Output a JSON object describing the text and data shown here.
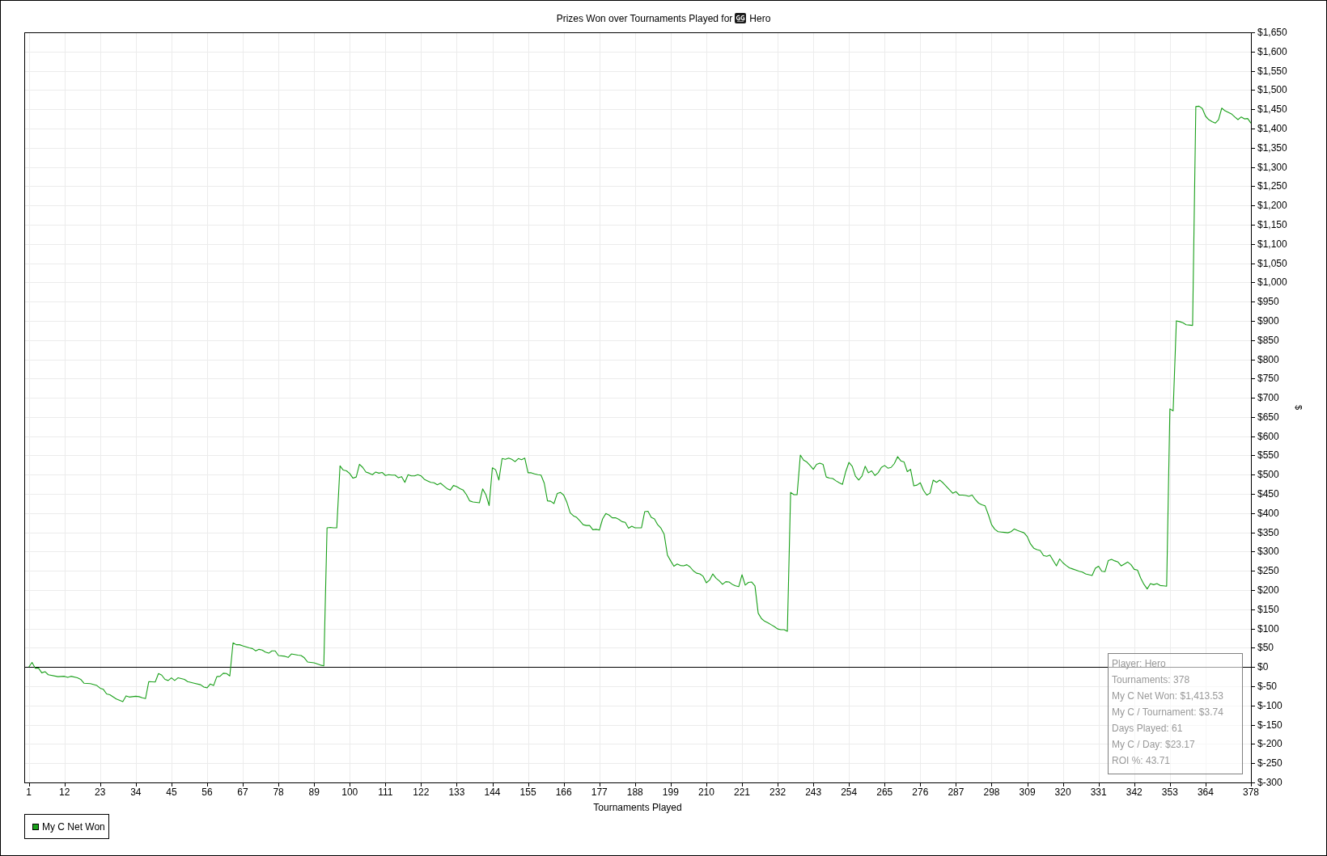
{
  "chart": {
    "title_player": "Hero",
    "summary_box": {
      "lines": [
        "Player: Hero",
        "Tournaments: 378",
        "My C Net Won: $1,413.53",
        "My C / Tournament: $3.74",
        "Days Played: 61",
        "My C / Day: $23.17",
        "ROI %: 43.71"
      ]
    },
    "chart_data": {
      "type": "line",
      "title": "Prizes Won over Tournaments Played for",
      "xlabel": "Tournaments Played",
      "ylabel": "$",
      "grid": true,
      "x": [
        1,
        2,
        3,
        4,
        5,
        6,
        7,
        10,
        12,
        13,
        14,
        16,
        17,
        18,
        20,
        22,
        23,
        24,
        25,
        26,
        28,
        30,
        31,
        32,
        34,
        35,
        36,
        37,
        38,
        40,
        41,
        42,
        43,
        44,
        45,
        46,
        47,
        49,
        50,
        52,
        54,
        55,
        56,
        57,
        58,
        59,
        60,
        61,
        62,
        63,
        64,
        65,
        66,
        67,
        69,
        70,
        71,
        72,
        73,
        74,
        75,
        76,
        77,
        78,
        80,
        81,
        82,
        84,
        85,
        86,
        87,
        88,
        89,
        91,
        92,
        93,
        94,
        95,
        96,
        97,
        98,
        99,
        100,
        101,
        102,
        103,
        104,
        105,
        106,
        107,
        108,
        109,
        110,
        111,
        112,
        113,
        114,
        115,
        116,
        117,
        118,
        119,
        120,
        121,
        122,
        123,
        124,
        125,
        126,
        127,
        128,
        129,
        130,
        131,
        132,
        133,
        134,
        135,
        136,
        137,
        138,
        139,
        140,
        141,
        142,
        143,
        144,
        145,
        146,
        147,
        148,
        149,
        150,
        151,
        152,
        153,
        154,
        155,
        156,
        157,
        158,
        159,
        160,
        161,
        162,
        163,
        164,
        165,
        166,
        167,
        168,
        169,
        170,
        171,
        172,
        173,
        174,
        175,
        176,
        177,
        178,
        179,
        180,
        181,
        182,
        183,
        184,
        185,
        186,
        187,
        188,
        189,
        190,
        191,
        192,
        193,
        194,
        195,
        196,
        197,
        198,
        199,
        200,
        201,
        202,
        203,
        204,
        205,
        206,
        207,
        208,
        209,
        210,
        211,
        212,
        213,
        214,
        215,
        216,
        217,
        218,
        219,
        220,
        221,
        222,
        223,
        224,
        225,
        226,
        227,
        228,
        229,
        230,
        231,
        232,
        233,
        234,
        235,
        236,
        237,
        238,
        239,
        240,
        241,
        242,
        243,
        244,
        245,
        246,
        247,
        248,
        249,
        250,
        251,
        252,
        253,
        254,
        255,
        256,
        257,
        258,
        259,
        260,
        261,
        262,
        263,
        264,
        265,
        266,
        267,
        268,
        269,
        270,
        271,
        272,
        273,
        274,
        275,
        276,
        277,
        278,
        279,
        280,
        281,
        282,
        283,
        284,
        285,
        286,
        287,
        288,
        289,
        290,
        291,
        292,
        293,
        294,
        295,
        296,
        297,
        298,
        299,
        300,
        301,
        302,
        303,
        304,
        305,
        306,
        307,
        308,
        309,
        310,
        311,
        312,
        313,
        314,
        315,
        316,
        317,
        318,
        319,
        320,
        321,
        322,
        323,
        324,
        325,
        326,
        327,
        328,
        329,
        330,
        331,
        332,
        333,
        334,
        335,
        336,
        337,
        338,
        339,
        340,
        341,
        342,
        343,
        344,
        345,
        346,
        347,
        348,
        349,
        350,
        351,
        352,
        353,
        354,
        355,
        356,
        357,
        358,
        359,
        360,
        361,
        362,
        363,
        364,
        365,
        366,
        367,
        368,
        369,
        370,
        371,
        372,
        373,
        374,
        375,
        376,
        377,
        378
      ],
      "series": [
        {
          "name": "My C Net Won",
          "color": "#1aa01a",
          "values": [
            0,
            12,
            -3,
            -3,
            -15,
            -12,
            -20,
            -25,
            -24,
            -27,
            -24,
            -28,
            -32,
            -42,
            -43,
            -48,
            -55,
            -58,
            -70,
            -72,
            -83,
            -90,
            -75,
            -78,
            -76,
            -77,
            -80,
            -82,
            -38,
            -39,
            -17,
            -21,
            -32,
            -35,
            -28,
            -35,
            -28,
            -32,
            -38,
            -42,
            -46,
            -52,
            -54,
            -44,
            -48,
            -25,
            -24,
            -16,
            -17,
            -23,
            63,
            58,
            58,
            55,
            50,
            48,
            42,
            46,
            44,
            39,
            36,
            42,
            42,
            30,
            28,
            25,
            34,
            31,
            30,
            24,
            13,
            12,
            11,
            5,
            3,
            362,
            363,
            362,
            362,
            523,
            512,
            510,
            503,
            491,
            494,
            527,
            519,
            507,
            504,
            500,
            507,
            504,
            506,
            498,
            500,
            499,
            499,
            492,
            495,
            480,
            500,
            497,
            497,
            500,
            497,
            488,
            484,
            480,
            479,
            474,
            478,
            471,
            464,
            460,
            472,
            469,
            464,
            460,
            448,
            432,
            429,
            428,
            427,
            463,
            448,
            420,
            518,
            513,
            486,
            542,
            540,
            543,
            540,
            534,
            542,
            539,
            543,
            505,
            505,
            502,
            500,
            499,
            478,
            432,
            431,
            425,
            451,
            454,
            447,
            428,
            401,
            393,
            389,
            380,
            370,
            368,
            368,
            357,
            358,
            356,
            385,
            399,
            395,
            388,
            388,
            384,
            378,
            376,
            361,
            366,
            362,
            362,
            362,
            404,
            405,
            389,
            385,
            370,
            361,
            345,
            291,
            276,
            262,
            268,
            264,
            263,
            266,
            260,
            250,
            244,
            242,
            236,
            219,
            226,
            242,
            231,
            224,
            215,
            222,
            221,
            215,
            211,
            209,
            240,
            213,
            220,
            221,
            211,
            140,
            126,
            119,
            115,
            110,
            105,
            99,
            97,
            97,
            93,
            454,
            448,
            448,
            551,
            538,
            533,
            524,
            514,
            527,
            530,
            527,
            494,
            491,
            490,
            484,
            479,
            475,
            508,
            532,
            522,
            496,
            486,
            496,
            522,
            505,
            510,
            498,
            505,
            519,
            524,
            517,
            519,
            529,
            547,
            536,
            533,
            508,
            514,
            471,
            473,
            479,
            459,
            447,
            452,
            486,
            480,
            486,
            479,
            470,
            461,
            452,
            456,
            447,
            447,
            446,
            444,
            447,
            435,
            426,
            422,
            419,
            396,
            370,
            358,
            352,
            351,
            350,
            349,
            352,
            359,
            355,
            352,
            349,
            339,
            320,
            309,
            305,
            303,
            290,
            288,
            291,
            277,
            263,
            281,
            271,
            264,
            258,
            255,
            252,
            249,
            247,
            242,
            240,
            238,
            257,
            262,
            249,
            248,
            277,
            280,
            276,
            273,
            263,
            268,
            273,
            266,
            254,
            252,
            231,
            215,
            203,
            217,
            214,
            217,
            212,
            211,
            210,
            671,
            666,
            900,
            898,
            895,
            890,
            889,
            888,
            1457,
            1458,
            1452,
            1432,
            1423,
            1418,
            1414,
            1423,
            1453,
            1446,
            1442,
            1438,
            1430,
            1423,
            1430,
            1425,
            1426,
            1414
          ]
        }
      ],
      "xlim": [
        0,
        378
      ],
      "ylim": [
        -300,
        1650
      ],
      "xticks": [
        1,
        12,
        23,
        34,
        45,
        56,
        67,
        78,
        89,
        100,
        111,
        122,
        133,
        144,
        155,
        166,
        177,
        188,
        199,
        210,
        221,
        232,
        243,
        254,
        265,
        276,
        287,
        298,
        309,
        320,
        331,
        342,
        353,
        364,
        378
      ],
      "yticks": [
        {
          "value": 1650,
          "label": "$1,650"
        },
        {
          "value": 1600,
          "label": "$1,600"
        },
        {
          "value": 1550,
          "label": "$1,550"
        },
        {
          "value": 1500,
          "label": "$1,500"
        },
        {
          "value": 1450,
          "label": "$1,450"
        },
        {
          "value": 1400,
          "label": "$1,400"
        },
        {
          "value": 1350,
          "label": "$1,350"
        },
        {
          "value": 1300,
          "label": "$1,300"
        },
        {
          "value": 1250,
          "label": "$1,250"
        },
        {
          "value": 1200,
          "label": "$1,200"
        },
        {
          "value": 1150,
          "label": "$1,150"
        },
        {
          "value": 1100,
          "label": "$1,100"
        },
        {
          "value": 1050,
          "label": "$1,050"
        },
        {
          "value": 1000,
          "label": "$1,000"
        },
        {
          "value": 950,
          "label": "$950"
        },
        {
          "value": 900,
          "label": "$900"
        },
        {
          "value": 850,
          "label": "$850"
        },
        {
          "value": 800,
          "label": "$800"
        },
        {
          "value": 750,
          "label": "$750"
        },
        {
          "value": 700,
          "label": "$700"
        },
        {
          "value": 650,
          "label": "$650"
        },
        {
          "value": 600,
          "label": "$600"
        },
        {
          "value": 550,
          "label": "$550"
        },
        {
          "value": 500,
          "label": "$500"
        },
        {
          "value": 450,
          "label": "$450"
        },
        {
          "value": 400,
          "label": "$400"
        },
        {
          "value": 350,
          "label": "$350"
        },
        {
          "value": 300,
          "label": "$300"
        },
        {
          "value": 250,
          "label": "$250"
        },
        {
          "value": 200,
          "label": "$200"
        },
        {
          "value": 150,
          "label": "$150"
        },
        {
          "value": 100,
          "label": "$100"
        },
        {
          "value": 50,
          "label": "$50"
        },
        {
          "value": 0,
          "label": "$0"
        },
        {
          "value": -50,
          "label": "$-50"
        },
        {
          "value": -100,
          "label": "$-100"
        },
        {
          "value": -150,
          "label": "$-150"
        },
        {
          "value": -200,
          "label": "$-200"
        },
        {
          "value": -250,
          "label": "$-250"
        },
        {
          "value": -300,
          "label": "$-300"
        }
      ]
    }
  }
}
